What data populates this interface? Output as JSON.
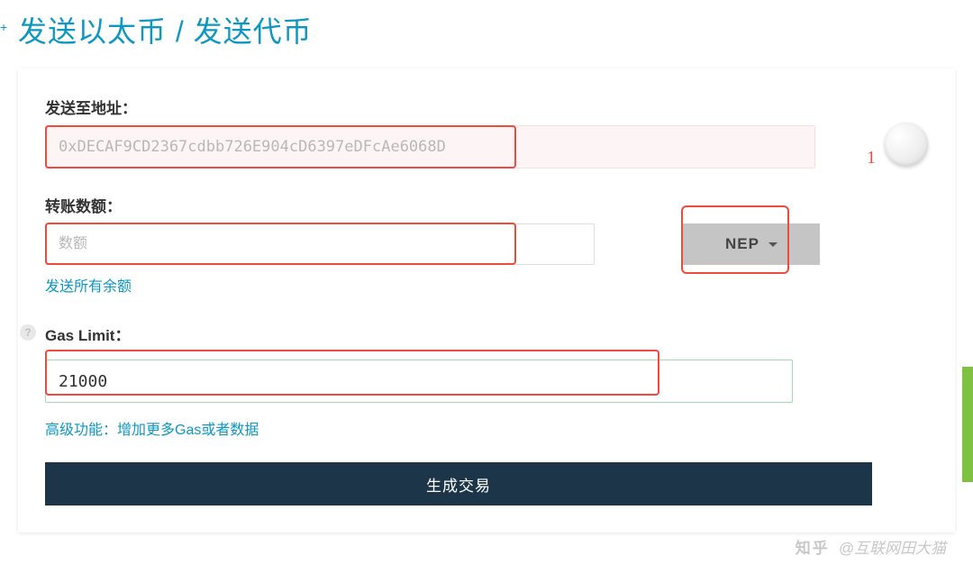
{
  "page": {
    "title": "发送以太币 / 发送代币"
  },
  "form": {
    "address": {
      "label": "发送至地址：",
      "placeholder": "0xDECAF9CD2367cdbb726E904cD6397eDFcAe6068D"
    },
    "amount": {
      "label": "转账数额：",
      "placeholder": "数额",
      "token_selected": "NEP",
      "send_all_link": "发送所有余额"
    },
    "gas": {
      "label": "Gas Limit：",
      "value": "21000",
      "advanced_link": "高级功能：增加更多Gas或者数据"
    },
    "submit_label": "生成交易"
  },
  "annotations": {
    "marker_1": "1"
  },
  "watermark": {
    "logo": "知乎",
    "author": "@互联网田大猫"
  }
}
